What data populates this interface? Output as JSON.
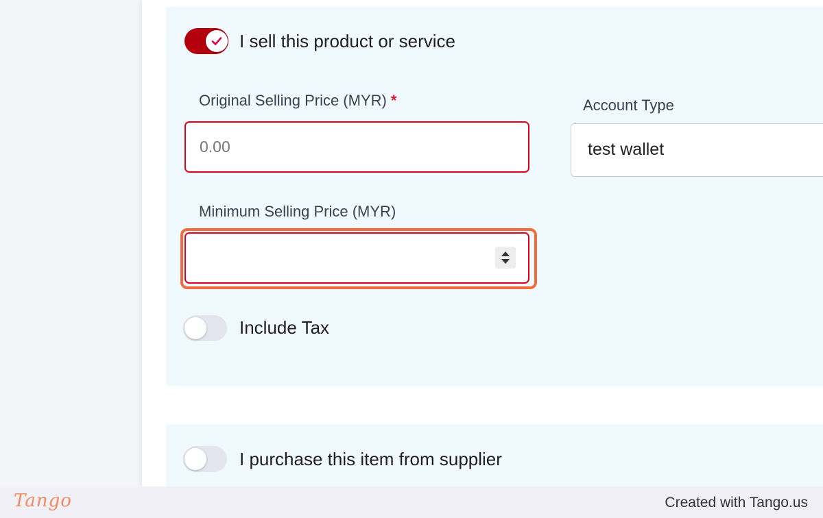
{
  "sell_section": {
    "toggle_label": "I sell this product or service",
    "toggle_state": "on",
    "original_price": {
      "label": "Original Selling Price (MYR)",
      "required_mark": "*",
      "placeholder": "0.00",
      "value": ""
    },
    "account_type": {
      "label": "Account Type",
      "value": "test wallet"
    },
    "minimum_price": {
      "label": "Minimum Selling Price (MYR)",
      "value": ""
    },
    "include_tax": {
      "label": "Include Tax",
      "state": "off"
    }
  },
  "purchase_section": {
    "toggle_label": "I purchase this item from supplier",
    "toggle_state": "off"
  },
  "footer": {
    "logo_text": "Tango",
    "credit_text": "Created with Tango.us"
  },
  "colors": {
    "toggle_on": "#b3000c",
    "error_border": "#e0001b",
    "highlight": "#f26b3a",
    "section_bg": "#f0f9fd"
  },
  "icons": {
    "toggle_check": "check-icon",
    "spinner": "spinner-arrows-icon"
  }
}
